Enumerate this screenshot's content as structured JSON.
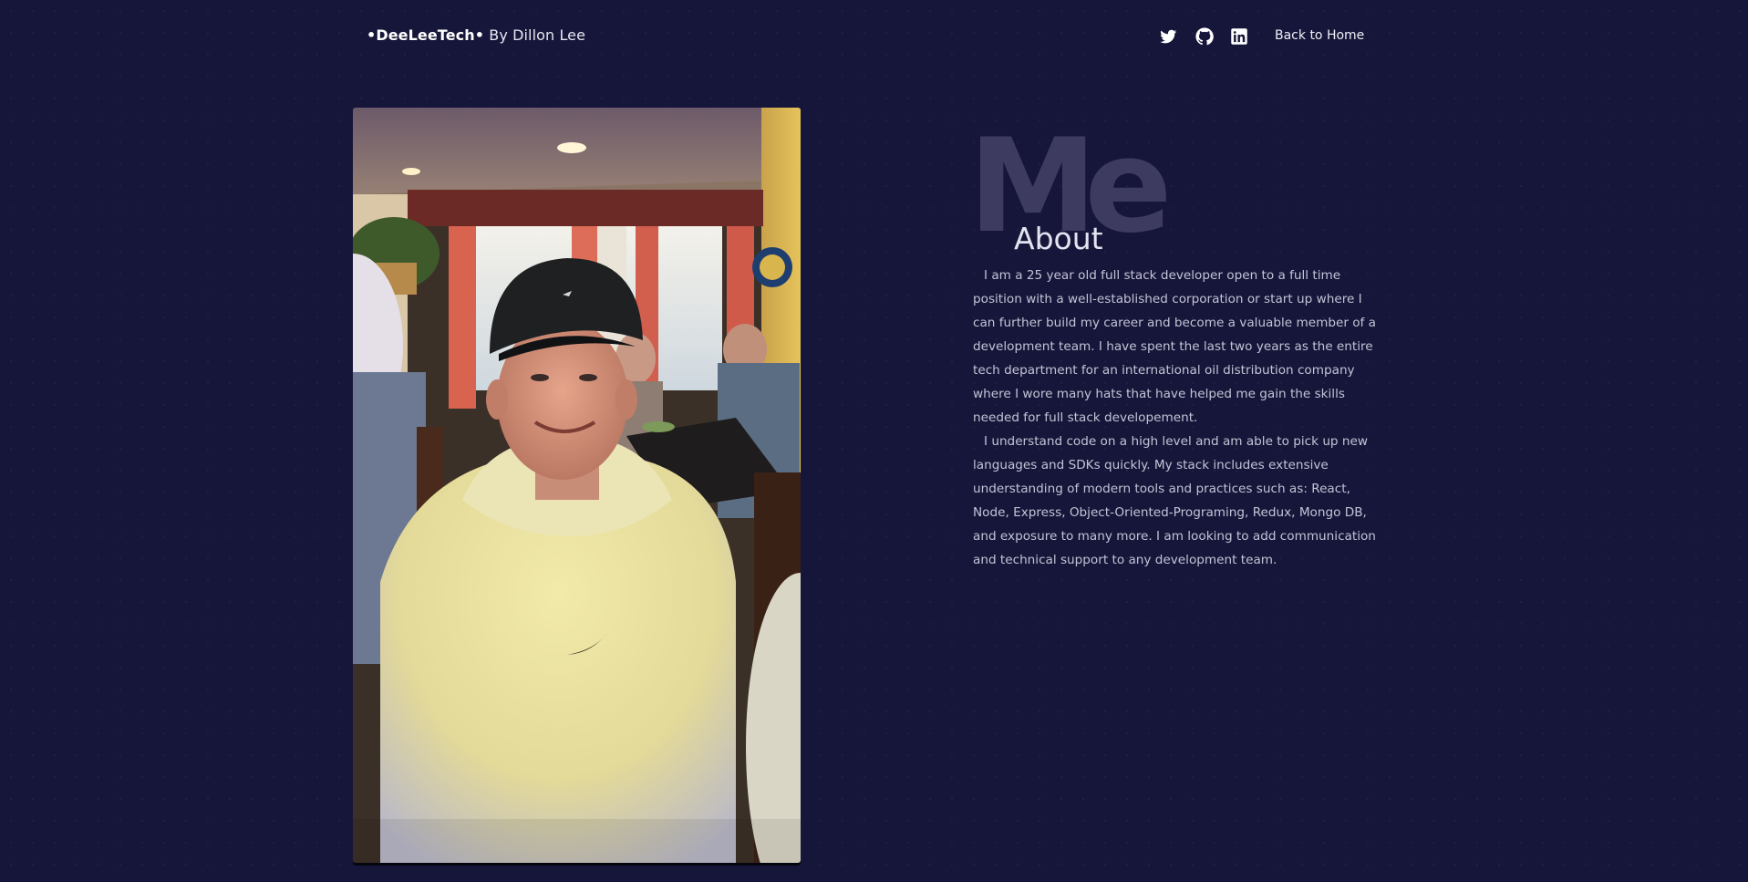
{
  "header": {
    "brand_name": "•DeeLeeTech•",
    "brand_suffix": " By Dillon Lee",
    "social_icons": [
      "twitter-icon",
      "github-icon",
      "linkedin-icon"
    ],
    "home_link_label": "Back to Home"
  },
  "photo": {
    "subject": "portrait-photo"
  },
  "about": {
    "background_word": "Me",
    "title": "About",
    "paragraphs": [
      "I am a 25 year old full stack developer open to a full time position with a well-established corporation or start up where I can further build my career and become a valuable member of a development team. I have spent the last two years as the entire tech department for an international oil distribution company where I wore many hats that have helped me gain the skills needed for full stack developement.",
      "I understand code on a high level and am able to pick up new languages and SDKs quickly. My stack includes extensive understanding of modern tools and practices such as: React, Node, Express, Object-Oriented-Programing, Redux, Mongo DB, and exposure to many more. I am looking to add communication and technical support to any development team."
    ]
  },
  "colors": {
    "background": "#16163a",
    "text": "#c3c3d6",
    "background_word": "#3d3c60"
  }
}
